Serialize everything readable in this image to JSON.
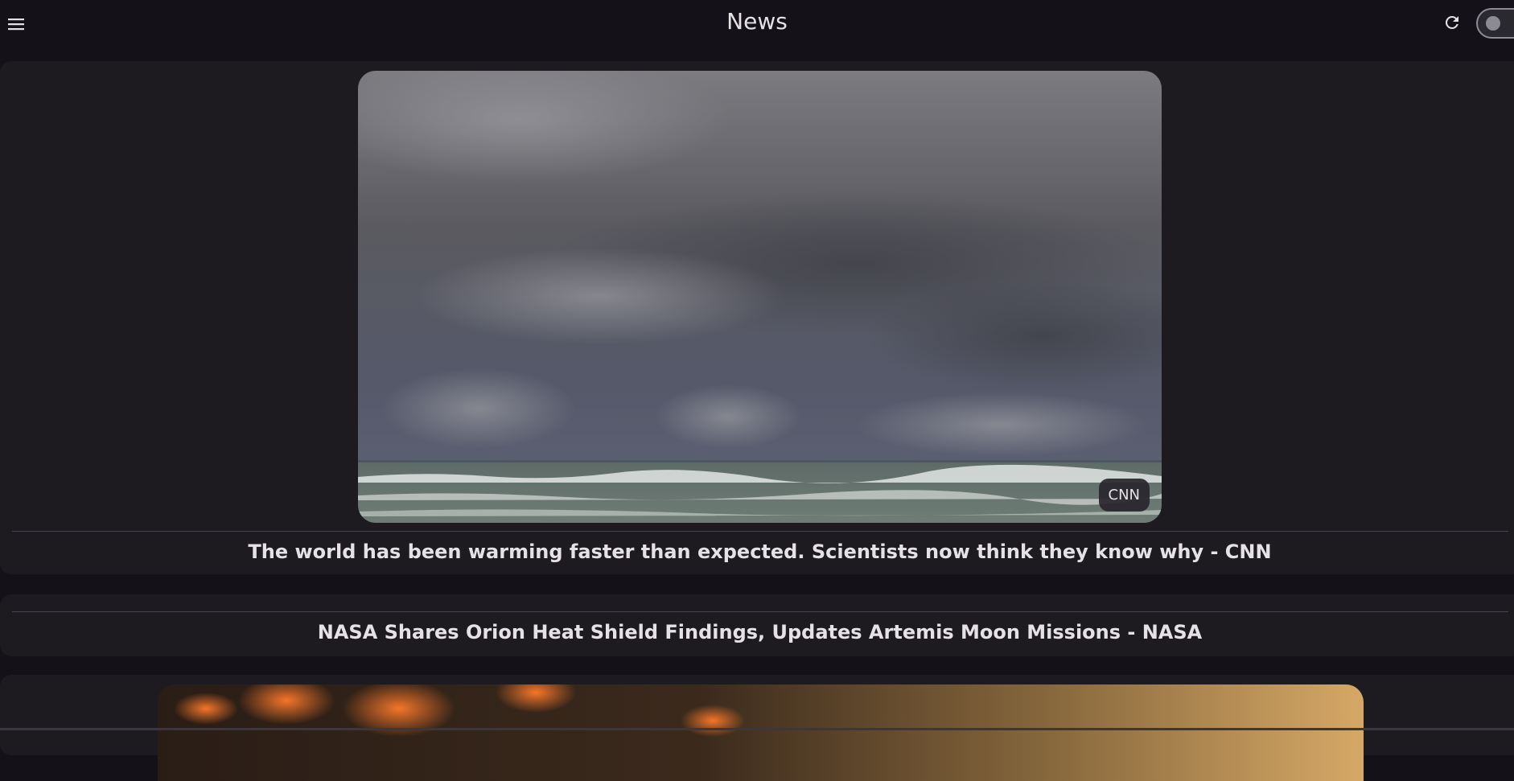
{
  "header": {
    "title": "News"
  },
  "icons": {
    "menu": "menu-icon",
    "refresh": "refresh-icon",
    "theme_toggle": "theme-toggle"
  },
  "colors": {
    "background": "#141218",
    "card": "#1d1b20",
    "text": "#e6e1e5",
    "divider": "#49454f"
  },
  "articles": [
    {
      "headline": "The world has been warming faster than expected. Scientists now think they know why - CNN",
      "source": "CNN",
      "has_image": true
    },
    {
      "headline": "NASA Shares Orion Heat Shield Findings, Updates Artemis Moon Missions - NASA",
      "has_image": false
    },
    {
      "has_image": true
    }
  ]
}
